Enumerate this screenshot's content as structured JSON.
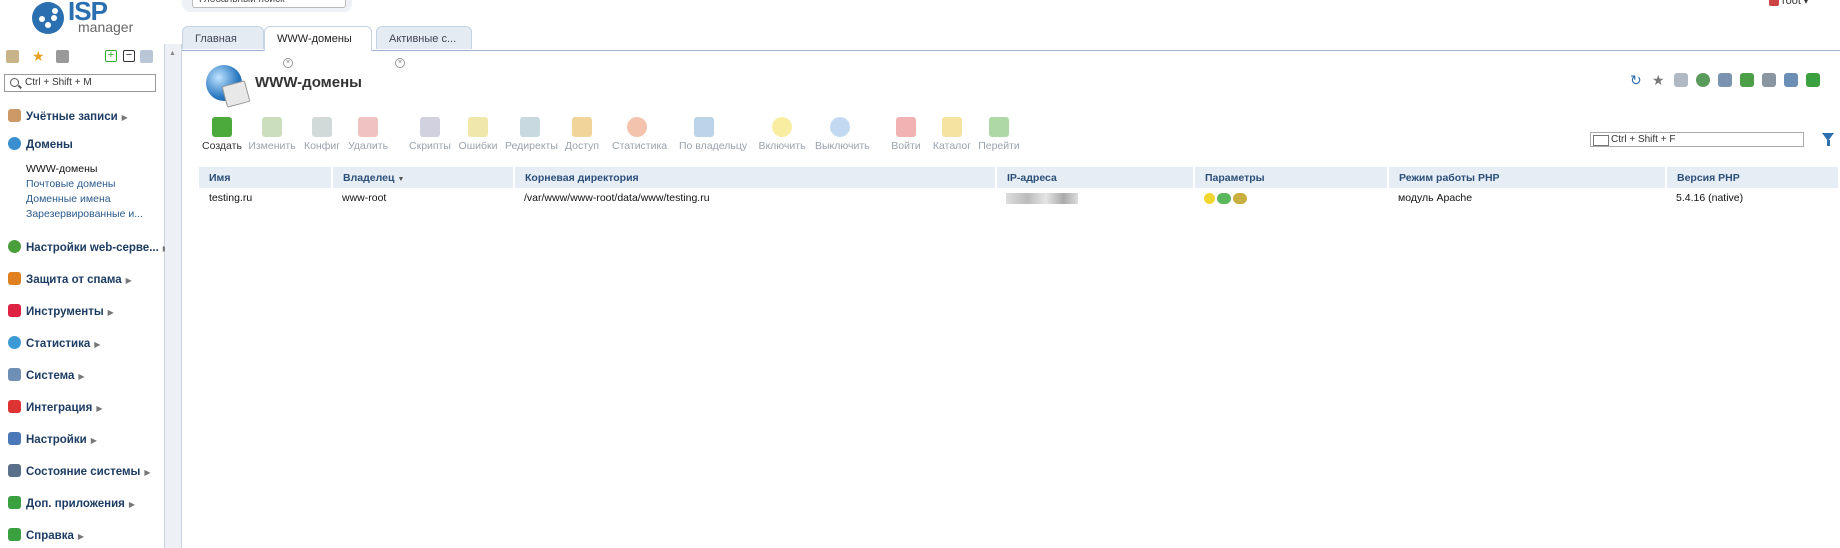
{
  "header": {
    "logo_text": "ISP",
    "logo_sub": "manager",
    "global_search_placeholder": "Глобальный поиск",
    "user": "root"
  },
  "tabs": [
    {
      "label": "Главная",
      "closable": false
    },
    {
      "label": "WWW-домены",
      "closable": true,
      "active": true
    },
    {
      "label": "Активные с...",
      "closable": true
    }
  ],
  "sidebar": {
    "search_placeholder": "Ctrl + Shift + M",
    "menu": [
      {
        "label": "Учётные записи",
        "icon": "users-icon",
        "color": "#c96"
      },
      {
        "label": "Домены",
        "icon": "globe-icon",
        "color": "#3a8fd0",
        "expanded": true,
        "children": [
          "WWW-домены",
          "Почтовые домены",
          "Доменные имена",
          "Зарезервированные и..."
        ]
      },
      {
        "label": "Настройки web-серве...",
        "icon": "web-settings-icon",
        "color": "#4a9f3a"
      },
      {
        "label": "Защита от спама",
        "icon": "spam-shield-icon",
        "color": "#e08020"
      },
      {
        "label": "Инструменты",
        "icon": "tools-icon",
        "color": "#d24"
      },
      {
        "label": "Статистика",
        "icon": "stats-globe-icon",
        "color": "#3c9ad5"
      },
      {
        "label": "Система",
        "icon": "system-icon",
        "color": "#6f8fb5"
      },
      {
        "label": "Интеграция",
        "icon": "integration-icon",
        "color": "#d33"
      },
      {
        "label": "Настройки",
        "icon": "settings-icon",
        "color": "#4a78b8"
      },
      {
        "label": "Состояние системы",
        "icon": "monitor-icon",
        "color": "#5a6f8a"
      },
      {
        "label": "Доп. приложения",
        "icon": "plus-apps-icon",
        "color": "#3aa040"
      },
      {
        "label": "Справка",
        "icon": "help-icon",
        "color": "#3aa040"
      }
    ]
  },
  "page": {
    "title": "WWW-домены",
    "table_search_placeholder": "Ctrl + Shift + F"
  },
  "toolbar": [
    {
      "label": "Создать",
      "enabled": true,
      "color": "#4caa3c",
      "icon": "create-icon"
    },
    {
      "label": "Изменить",
      "enabled": false,
      "color": "#8fb86a",
      "icon": "edit-icon"
    },
    {
      "label": "Конфиг",
      "enabled": false,
      "color": "#9aa",
      "icon": "config-icon"
    },
    {
      "label": "Удалить",
      "enabled": false,
      "color": "#d77",
      "icon": "delete-icon"
    },
    {
      "label": "Скрипты",
      "enabled": false,
      "color": "#99b",
      "icon": "scripts-icon"
    },
    {
      "label": "Ошибки",
      "enabled": false,
      "color": "#dc4",
      "icon": "errors-icon"
    },
    {
      "label": "Редиректы",
      "enabled": false,
      "color": "#8ab",
      "icon": "redirects-icon"
    },
    {
      "label": "Доступ",
      "enabled": false,
      "color": "#e0a020",
      "icon": "lock-icon"
    },
    {
      "label": "Статистика",
      "enabled": false,
      "color": "#e47b4a",
      "icon": "pie-chart-icon"
    },
    {
      "label": "По владельцу",
      "enabled": false,
      "color": "#6aa0d0",
      "icon": "filter-owner-icon"
    },
    {
      "label": "Включить",
      "enabled": false,
      "color": "#f2d630",
      "icon": "bulb-on-icon"
    },
    {
      "label": "Выключить",
      "enabled": false,
      "color": "#7aa8e0",
      "icon": "bulb-off-icon"
    },
    {
      "label": "Войти",
      "enabled": false,
      "color": "#d55",
      "icon": "login-icon"
    },
    {
      "label": "Каталог",
      "enabled": false,
      "color": "#e8c030",
      "icon": "folder-icon"
    },
    {
      "label": "Перейти",
      "enabled": false,
      "color": "#4caa3c",
      "icon": "go-icon"
    }
  ],
  "table": {
    "columns": [
      "Имя",
      "Владелец",
      "Корневая директория",
      "IP-адреса",
      "Параметры",
      "Режим работы PHP",
      "Версия PHP"
    ],
    "sorted_column": "Владелец",
    "rows": [
      {
        "name": "testing.ru",
        "owner": "www-root",
        "root": "/var/www/www-root/data/www/testing.ru",
        "ip": "",
        "params": [
          "bulb-icon",
          "php-icon",
          "ssi-icon"
        ],
        "php_mode": "модуль Apache",
        "php_version": "5.4.16 (native)"
      }
    ]
  }
}
